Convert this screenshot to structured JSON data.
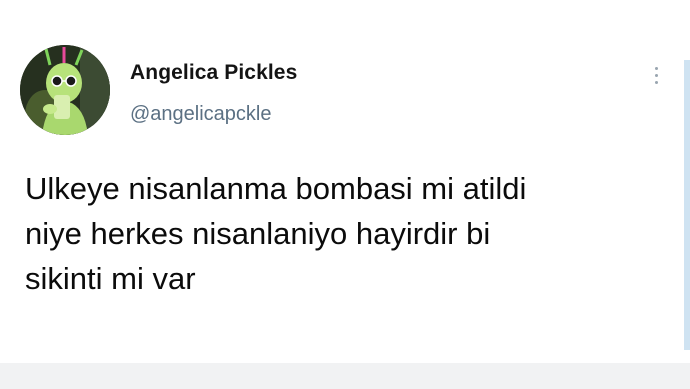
{
  "tweet": {
    "author": {
      "display_name": "Angelica Pickles",
      "handle": "@angelicapckle",
      "avatar_icon": "profile-photo"
    },
    "text_lines": [
      "Ulkeye nisanlanma bombasi mi atildi",
      "niye herkes nisanlaniyo hayirdir bi",
      "sikinti mi var"
    ],
    "more_icon": "vertical-ellipsis-icon"
  },
  "colors": {
    "name": "#141414",
    "handle": "#5b7083",
    "text": "#0b0b0b",
    "background": "#ffffff",
    "scrollbar": "#cfe3f2"
  }
}
